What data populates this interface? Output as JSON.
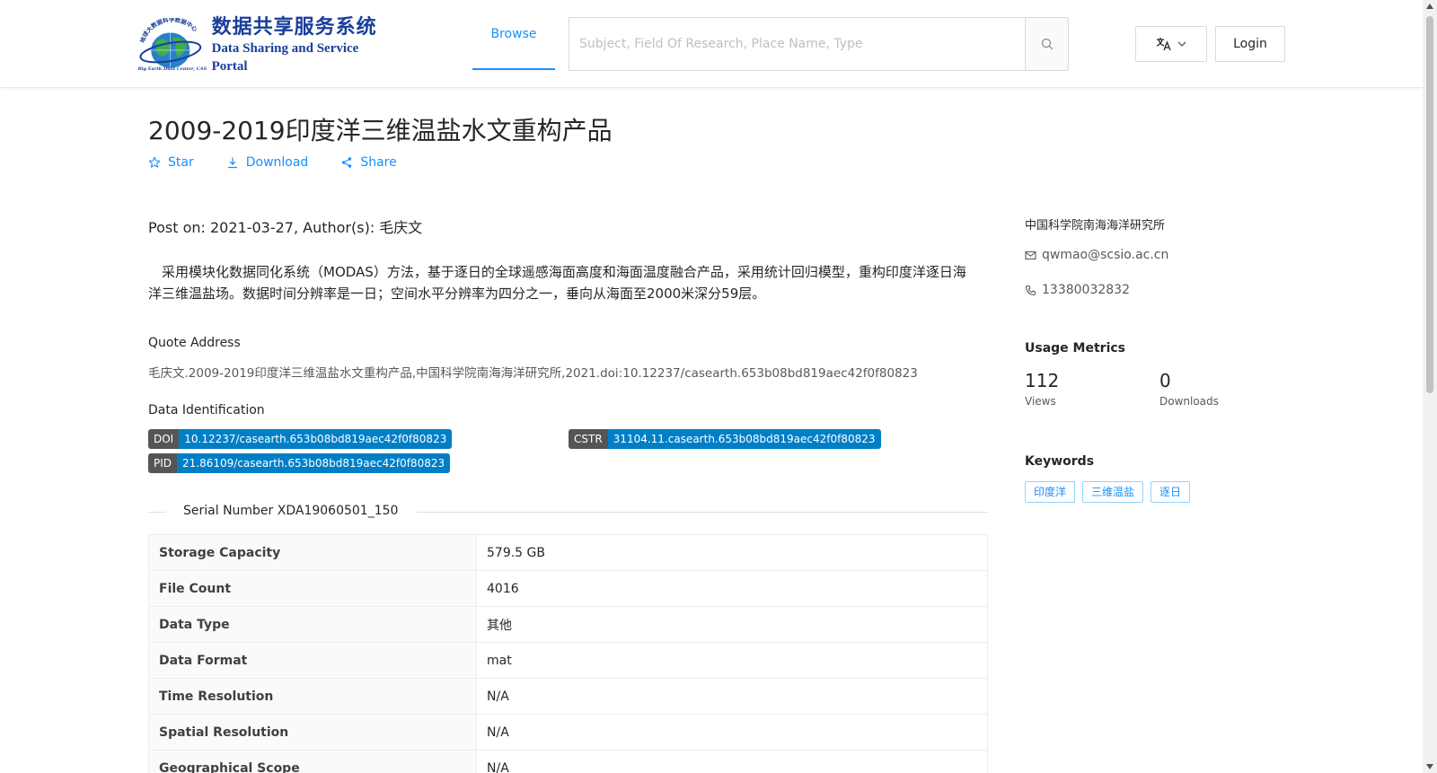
{
  "header": {
    "logo_cn": "数据共享服务系统",
    "logo_en": "Data Sharing and Service Portal",
    "logo_ring_text": "地球大数据科学数据中心",
    "logo_ring_text_en": "Big Earth Data Center, CAS",
    "nav_browse": "Browse",
    "search_placeholder": "Subject, Field Of Research, Place Name, Type",
    "login": "Login"
  },
  "dataset": {
    "title": "2009-2019印度洋三维温盐水文重构产品",
    "actions": {
      "star": "Star",
      "download": "Download",
      "share": "Share"
    },
    "post_on": "Post on: 2021-03-27, Author(s): 毛庆文",
    "description": "采用模块化数据同化系统（MODAS）方法，基于逐日的全球遥感海面高度和海面温度融合产品，采用统计回归模型，重构印度洋逐日海洋三维温盐场。数据时间分辨率是一日；空间水平分辨率为四分之一，垂向从海面至2000米深分59层。",
    "quote_label": "Quote Address",
    "quote_text": "毛庆文.2009-2019印度洋三维温盐水文重构产品,中国科学院南海海洋研究所,2021.doi:10.12237/casearth.653b08bd819aec42f0f80823",
    "identification_label": "Data Identification",
    "badges": {
      "doi_key": "DOI",
      "doi_val": "10.12237/casearth.653b08bd819aec42f0f80823",
      "cstr_key": "CSTR",
      "cstr_val": "31104.11.casearth.653b08bd819aec42f0f80823",
      "pid_key": "PID",
      "pid_val": "21.86109/casearth.653b08bd819aec42f0f80823"
    },
    "serial_number": "Serial Number XDA19060501_150",
    "info_rows": [
      {
        "key": "Storage Capacity",
        "value": "579.5 GB"
      },
      {
        "key": "File Count",
        "value": "4016"
      },
      {
        "key": "Data Type",
        "value": "其他"
      },
      {
        "key": "Data Format",
        "value": "mat"
      },
      {
        "key": "Time Resolution",
        "value": "N/A"
      },
      {
        "key": "Spatial Resolution",
        "value": "N/A"
      },
      {
        "key": "Geographical Scope",
        "value": "N/A"
      }
    ]
  },
  "sidebar": {
    "organization": "中国科学院南海海洋研究所",
    "email": "qwmao@scsio.ac.cn",
    "phone": "13380032832",
    "metrics_title": "Usage Metrics",
    "views_value": "112",
    "views_label": "Views",
    "downloads_value": "0",
    "downloads_label": "Downloads",
    "keywords_title": "Keywords",
    "keywords": [
      "印度洋",
      "三维温盐",
      "逐日"
    ]
  },
  "colors": {
    "accent": "#1890ff",
    "badge_key": "#555555",
    "badge_value": "#007ec6",
    "logo": "#1a3f9a"
  }
}
